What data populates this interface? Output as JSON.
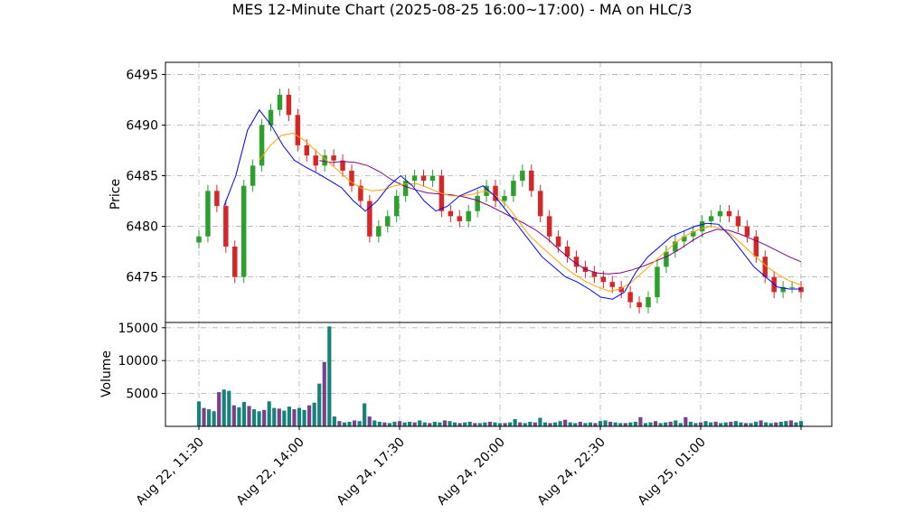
{
  "chart_data": {
    "type": "candlestick",
    "title": "MES 12-Minute Chart (2025-08-25 16:00~17:00) - MA on HLC/3",
    "price_panel": {
      "ylabel": "Price",
      "yticks": [
        6475,
        6480,
        6485,
        6490,
        6495
      ],
      "ylim": [
        6470.5,
        6496.2
      ],
      "grid": true
    },
    "volume_panel": {
      "ylabel": "Volume",
      "yticks": [
        5000,
        10000,
        15000
      ],
      "yticklabels": [
        "5000",
        "10000",
        "15000"
      ],
      "ylim": [
        0,
        15800
      ],
      "grid": true
    },
    "xticks": [
      {
        "index": 0,
        "label": "Aug 22, 11:30"
      },
      {
        "index": 20,
        "label": "Aug 22, 14:00"
      },
      {
        "index": 40,
        "label": "Aug 24, 17:30"
      },
      {
        "index": 60,
        "label": "Aug 24, 20:00"
      },
      {
        "index": 80,
        "label": "Aug 24, 22:30"
      },
      {
        "index": 100,
        "label": "Aug 25, 01:00"
      },
      {
        "index": 120,
        "label": ""
      }
    ],
    "x_count": 121,
    "colors": {
      "up": "#2ca02c",
      "down": "#d62728",
      "ma_fast": "#0000ff",
      "ma_mid": "#ffa500",
      "ma_slow": "#800080",
      "vol_up": "#17827a",
      "vol_down": "#7b3f8c"
    },
    "close": [
      6479,
      6483.5,
      6482,
      6478,
      6475,
      6484,
      6486,
      6490,
      6491.5,
      6493,
      6491,
      6488,
      6487,
      6486,
      6487,
      6486.5,
      6485.5,
      6484,
      6482.5,
      6479,
      6480,
      6481,
      6483,
      6484.5,
      6485,
      6484.5,
      6485,
      6481.5,
      6481,
      6480.5,
      6481.5,
      6483,
      6484,
      6482.5,
      6483,
      6484.5,
      6485.5,
      6483.5,
      6481,
      6479,
      6478,
      6477,
      6476,
      6475.5,
      6475,
      6474.5,
      6474,
      6473.5,
      6472.5,
      6472,
      6473,
      6476,
      6477.5,
      6478.5,
      6479,
      6479.5,
      6480.5,
      6481,
      6481.5,
      6481,
      6480,
      6479,
      6477,
      6475,
      6473.5,
      6474,
      6474,
      6473.5
    ],
    "ma_fast": [
      6482,
      6485,
      6489.5,
      6491.5,
      6490,
      6488,
      6486.5,
      6485.8,
      6485.2,
      6484.5,
      6483.8,
      6482.5,
      6481.5,
      6482.5,
      6484,
      6485,
      6484,
      6482.5,
      6481.5,
      6482,
      6483,
      6483.5,
      6484,
      6483,
      6481.5,
      6480,
      6478.5,
      6477,
      6476,
      6475,
      6474.5,
      6473.8,
      6473,
      6472.8,
      6473.5,
      6475.5,
      6477,
      6478,
      6479,
      6479.5,
      6480,
      6480.3,
      6480.2,
      6479,
      6477.5,
      6476,
      6475,
      6474,
      6473.8,
      6473.8
    ],
    "ma_mid": [
      6486.5,
      6488,
      6489,
      6489.2,
      6488.5,
      6487.5,
      6486.5,
      6485.5,
      6484.5,
      6483.8,
      6483.5,
      6483.6,
      6484,
      6484.2,
      6484.2,
      6483.8,
      6483.3,
      6483,
      6483,
      6483.2,
      6483.5,
      6483,
      6482,
      6480.5,
      6479,
      6478,
      6477,
      6476,
      6475.2,
      6474.5,
      6474,
      6473.6,
      6473.8,
      6474.5,
      6475.5,
      6476.5,
      6477.5,
      6478.5,
      6479.2,
      6479.7,
      6480,
      6479.8,
      6479,
      6478,
      6477,
      6476,
      6475.2,
      6474.6,
      6474.2
    ],
    "ma_slow": [
      6486.5,
      6486.3,
      6486.4,
      6486.3,
      6486,
      6485.4,
      6484.6,
      6484,
      6483.6,
      6483.3,
      6483.2,
      6483.1,
      6482.9,
      6482.6,
      6482.1,
      6481.5,
      6480.9,
      6480.3,
      6479.6,
      6478.7,
      6477.6,
      6476.6,
      6475.8,
      6475.4,
      6475.3,
      6475.4,
      6475.7,
      6476.1,
      6476.6,
      6477.1,
      6477.8,
      6478.6,
      6479.3,
      6479.7,
      6479.6,
      6479.2,
      6478.7,
      6478.2,
      6477.6,
      6477,
      6476.5
    ],
    "volume_note": "",
    "volume": [
      3800,
      2800,
      2600,
      2300,
      5200,
      5600,
      5400,
      3200,
      2900,
      3700,
      3100,
      2600,
      2300,
      2500,
      3800,
      2800,
      2700,
      2400,
      3000,
      2600,
      2800,
      2500,
      3200,
      3600,
      6500,
      9800,
      15200,
      1500,
      800,
      600,
      700,
      900,
      800,
      3500,
      1500,
      900,
      700,
      600,
      500,
      700,
      800,
      600,
      700,
      600,
      900,
      600,
      500,
      700,
      600,
      900,
      800,
      600,
      500,
      600,
      700,
      500,
      500,
      600,
      700,
      600,
      500,
      500,
      600,
      1100,
      600,
      500,
      700,
      600,
      1300,
      600,
      500,
      600,
      800,
      1000,
      600,
      500,
      700,
      500,
      600,
      500,
      800,
      900,
      700,
      600,
      500,
      500,
      600,
      700,
      1400,
      500,
      600,
      800,
      500,
      600,
      700,
      900,
      500,
      1400,
      700,
      500,
      600,
      800,
      600,
      700,
      500,
      600,
      700,
      800,
      600,
      500,
      500,
      700,
      900,
      600,
      500,
      600,
      700,
      800,
      900,
      600,
      800
    ]
  }
}
